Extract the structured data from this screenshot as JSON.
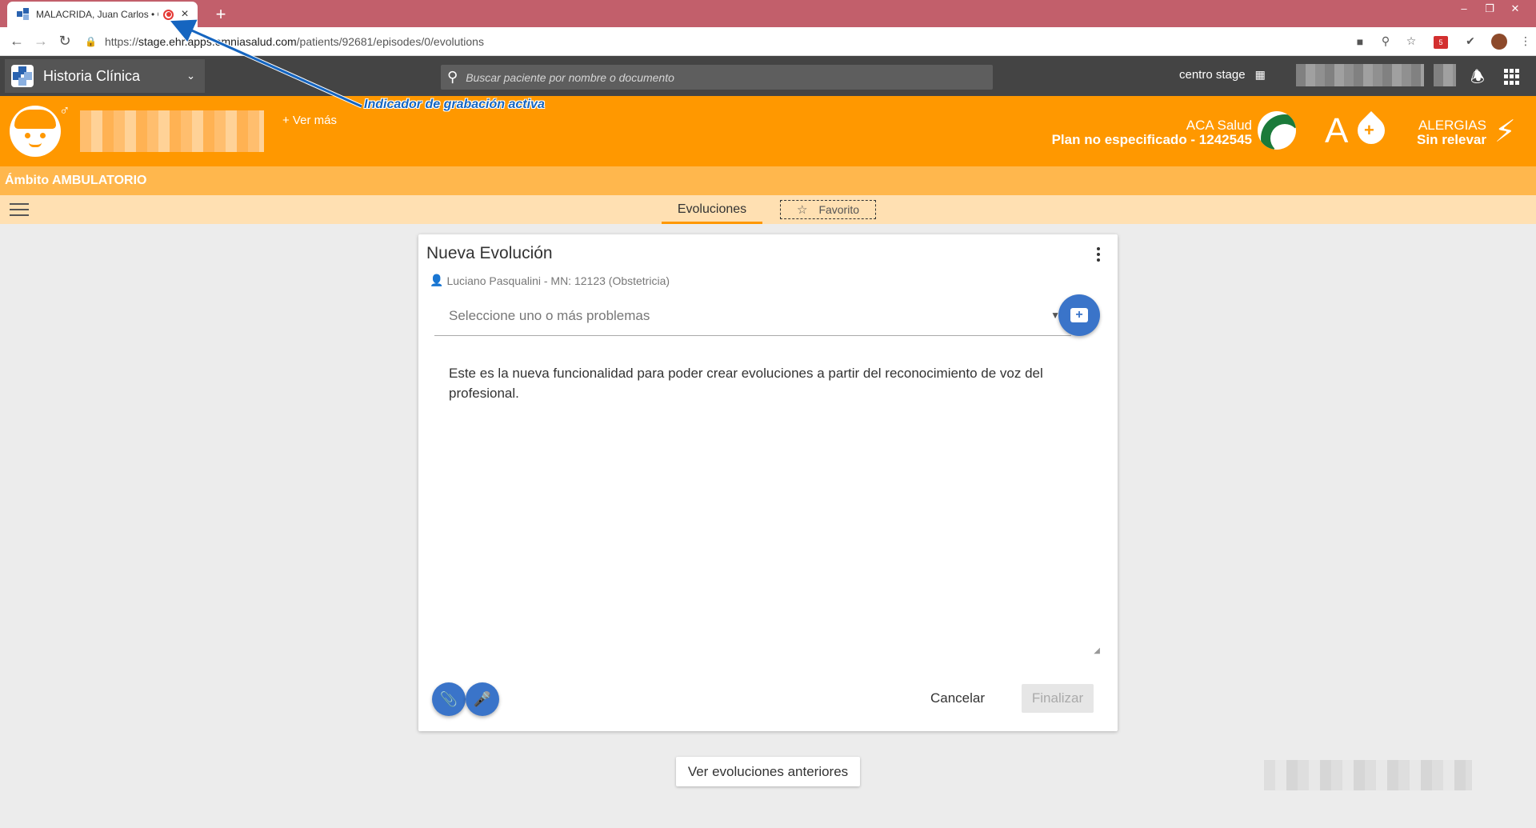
{
  "browser": {
    "tab_title": "MALACRIDA, Juan Carlos • C",
    "tab_close": "×",
    "new_tab": "+",
    "url_prefix": "https://",
    "url_host": "stage.ehr.apps.omniasalud.com",
    "url_path": "/patients/92681/episodes/0/evolutions",
    "ext_badge_count": "5"
  },
  "appbar": {
    "app_name": "Historia Clínica",
    "search_placeholder": "Buscar paciente por nombre o documento",
    "center_name": "centro stage"
  },
  "patient": {
    "ver_mas": "+ Ver más",
    "insurer_name": "ACA Salud",
    "insurer_plan": "Plan no especificado - 1242545",
    "blood_type": "A",
    "allergies_label": "ALERGIAS",
    "allergies_value": "Sin relevar"
  },
  "annotation": {
    "text": "Indicador de grabación activa"
  },
  "scope": {
    "label": "Ámbito AMBULATORIO"
  },
  "tabs": {
    "evoluciones": "Evoluciones",
    "favorito": "Favorito"
  },
  "card": {
    "title": "Nueva Evolución",
    "professional": "Luciano Pasqualini - MN: 12123 (Obstetricia)",
    "problems_placeholder": "Seleccione uno o más problemas",
    "body_text": "Este es la nueva funcionalidad para poder crear evoluciones a partir del reconocimiento de voz del profesional.",
    "cancel_label": "Cancelar",
    "finalize_label": "Finalizar"
  },
  "footer": {
    "previous_label": "Ver evoluciones anteriores"
  },
  "colors": {
    "tabstrip": "#c25f6b",
    "appbar": "#444444",
    "patient_banner": "#ff9800",
    "scope_bar": "#ffb74d",
    "tabs_bar": "#ffe0b2",
    "accent_blue": "#3a74c9",
    "recording_red": "#e53935"
  }
}
